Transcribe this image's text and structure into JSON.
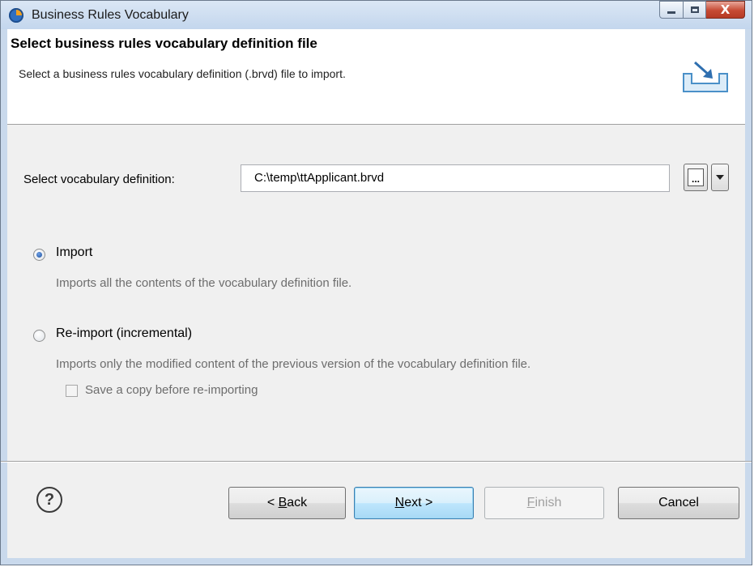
{
  "window": {
    "title": "Business Rules Vocabulary",
    "close_glyph": "X"
  },
  "header": {
    "title": "Select business rules vocabulary definition file",
    "description": "Select a business rules vocabulary definition (.brvd) file to import.",
    "icon": "import-tray-icon"
  },
  "file_select": {
    "label": "Select vocabulary definition:",
    "value": "C:\\temp\\ttApplicant.brvd",
    "browse_label": "...",
    "dropdown_icon": "chevron-down-icon"
  },
  "options": {
    "selected": "import",
    "import": {
      "label": "Import",
      "description": "Imports all the contents of the vocabulary definition file."
    },
    "reimport": {
      "label": "Re-import (incremental)",
      "description": "Imports only the modified content of the previous version of the vocabulary definition file.",
      "save_copy_label": "Save a copy before re-importing",
      "save_copy_checked": false
    }
  },
  "footer": {
    "help_glyph": "?",
    "back_prefix": "< ",
    "back_mnemonic": "B",
    "back_rest": "ack",
    "next_mnemonic": "N",
    "next_rest": "ext >",
    "finish_mnemonic": "F",
    "finish_rest": "inish",
    "cancel_label": "Cancel"
  },
  "colors": {
    "title_gradient_top": "#dbe7f5",
    "close_button_red": "#c64a33",
    "default_button_blue": "#3c7fb1",
    "disabled_text": "#a0a0a0"
  }
}
